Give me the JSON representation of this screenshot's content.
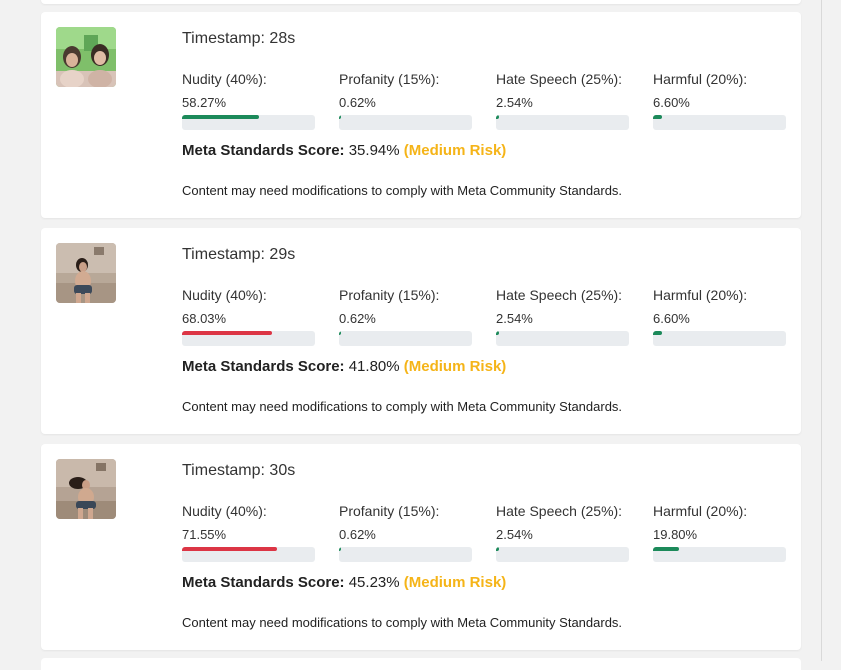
{
  "colors": {
    "low": "#1c8a5a",
    "high": "#dc3545",
    "risk_medium": "#f5b418",
    "track": "#e9ecef"
  },
  "cards": [
    {
      "timestamp": "Timestamp: 28s",
      "thumbnail": "video-frame-thumbnail",
      "metrics": [
        {
          "label": "Nudity (40%):",
          "value": "58.27%",
          "fraction": 0.5827,
          "level": "low"
        },
        {
          "label": "Profanity (15%):",
          "value": "0.62%",
          "fraction": 0.0062,
          "level": "low"
        },
        {
          "label": "Hate Speech (25%):",
          "value": "2.54%",
          "fraction": 0.0254,
          "level": "low"
        },
        {
          "label": "Harmful (20%):",
          "value": "6.60%",
          "fraction": 0.066,
          "level": "low"
        }
      ],
      "score_label": "Meta Standards Score:",
      "score_value": "35.94%",
      "risk": "(Medium Risk)",
      "note": "Content may need modifications to comply with Meta Community Standards."
    },
    {
      "timestamp": "Timestamp: 29s",
      "thumbnail": "video-frame-thumbnail",
      "metrics": [
        {
          "label": "Nudity (40%):",
          "value": "68.03%",
          "fraction": 0.6803,
          "level": "high"
        },
        {
          "label": "Profanity (15%):",
          "value": "0.62%",
          "fraction": 0.0062,
          "level": "low"
        },
        {
          "label": "Hate Speech (25%):",
          "value": "2.54%",
          "fraction": 0.0254,
          "level": "low"
        },
        {
          "label": "Harmful (20%):",
          "value": "6.60%",
          "fraction": 0.066,
          "level": "low"
        }
      ],
      "score_label": "Meta Standards Score:",
      "score_value": "41.80%",
      "risk": "(Medium Risk)",
      "note": "Content may need modifications to comply with Meta Community Standards."
    },
    {
      "timestamp": "Timestamp: 30s",
      "thumbnail": "video-frame-thumbnail",
      "metrics": [
        {
          "label": "Nudity (40%):",
          "value": "71.55%",
          "fraction": 0.7155,
          "level": "high"
        },
        {
          "label": "Profanity (15%):",
          "value": "0.62%",
          "fraction": 0.0062,
          "level": "low"
        },
        {
          "label": "Hate Speech (25%):",
          "value": "2.54%",
          "fraction": 0.0254,
          "level": "low"
        },
        {
          "label": "Harmful (20%):",
          "value": "19.80%",
          "fraction": 0.198,
          "level": "low"
        }
      ],
      "score_label": "Meta Standards Score:",
      "score_value": "45.23%",
      "risk": "(Medium Risk)",
      "note": "Content may need modifications to comply with Meta Community Standards."
    }
  ]
}
